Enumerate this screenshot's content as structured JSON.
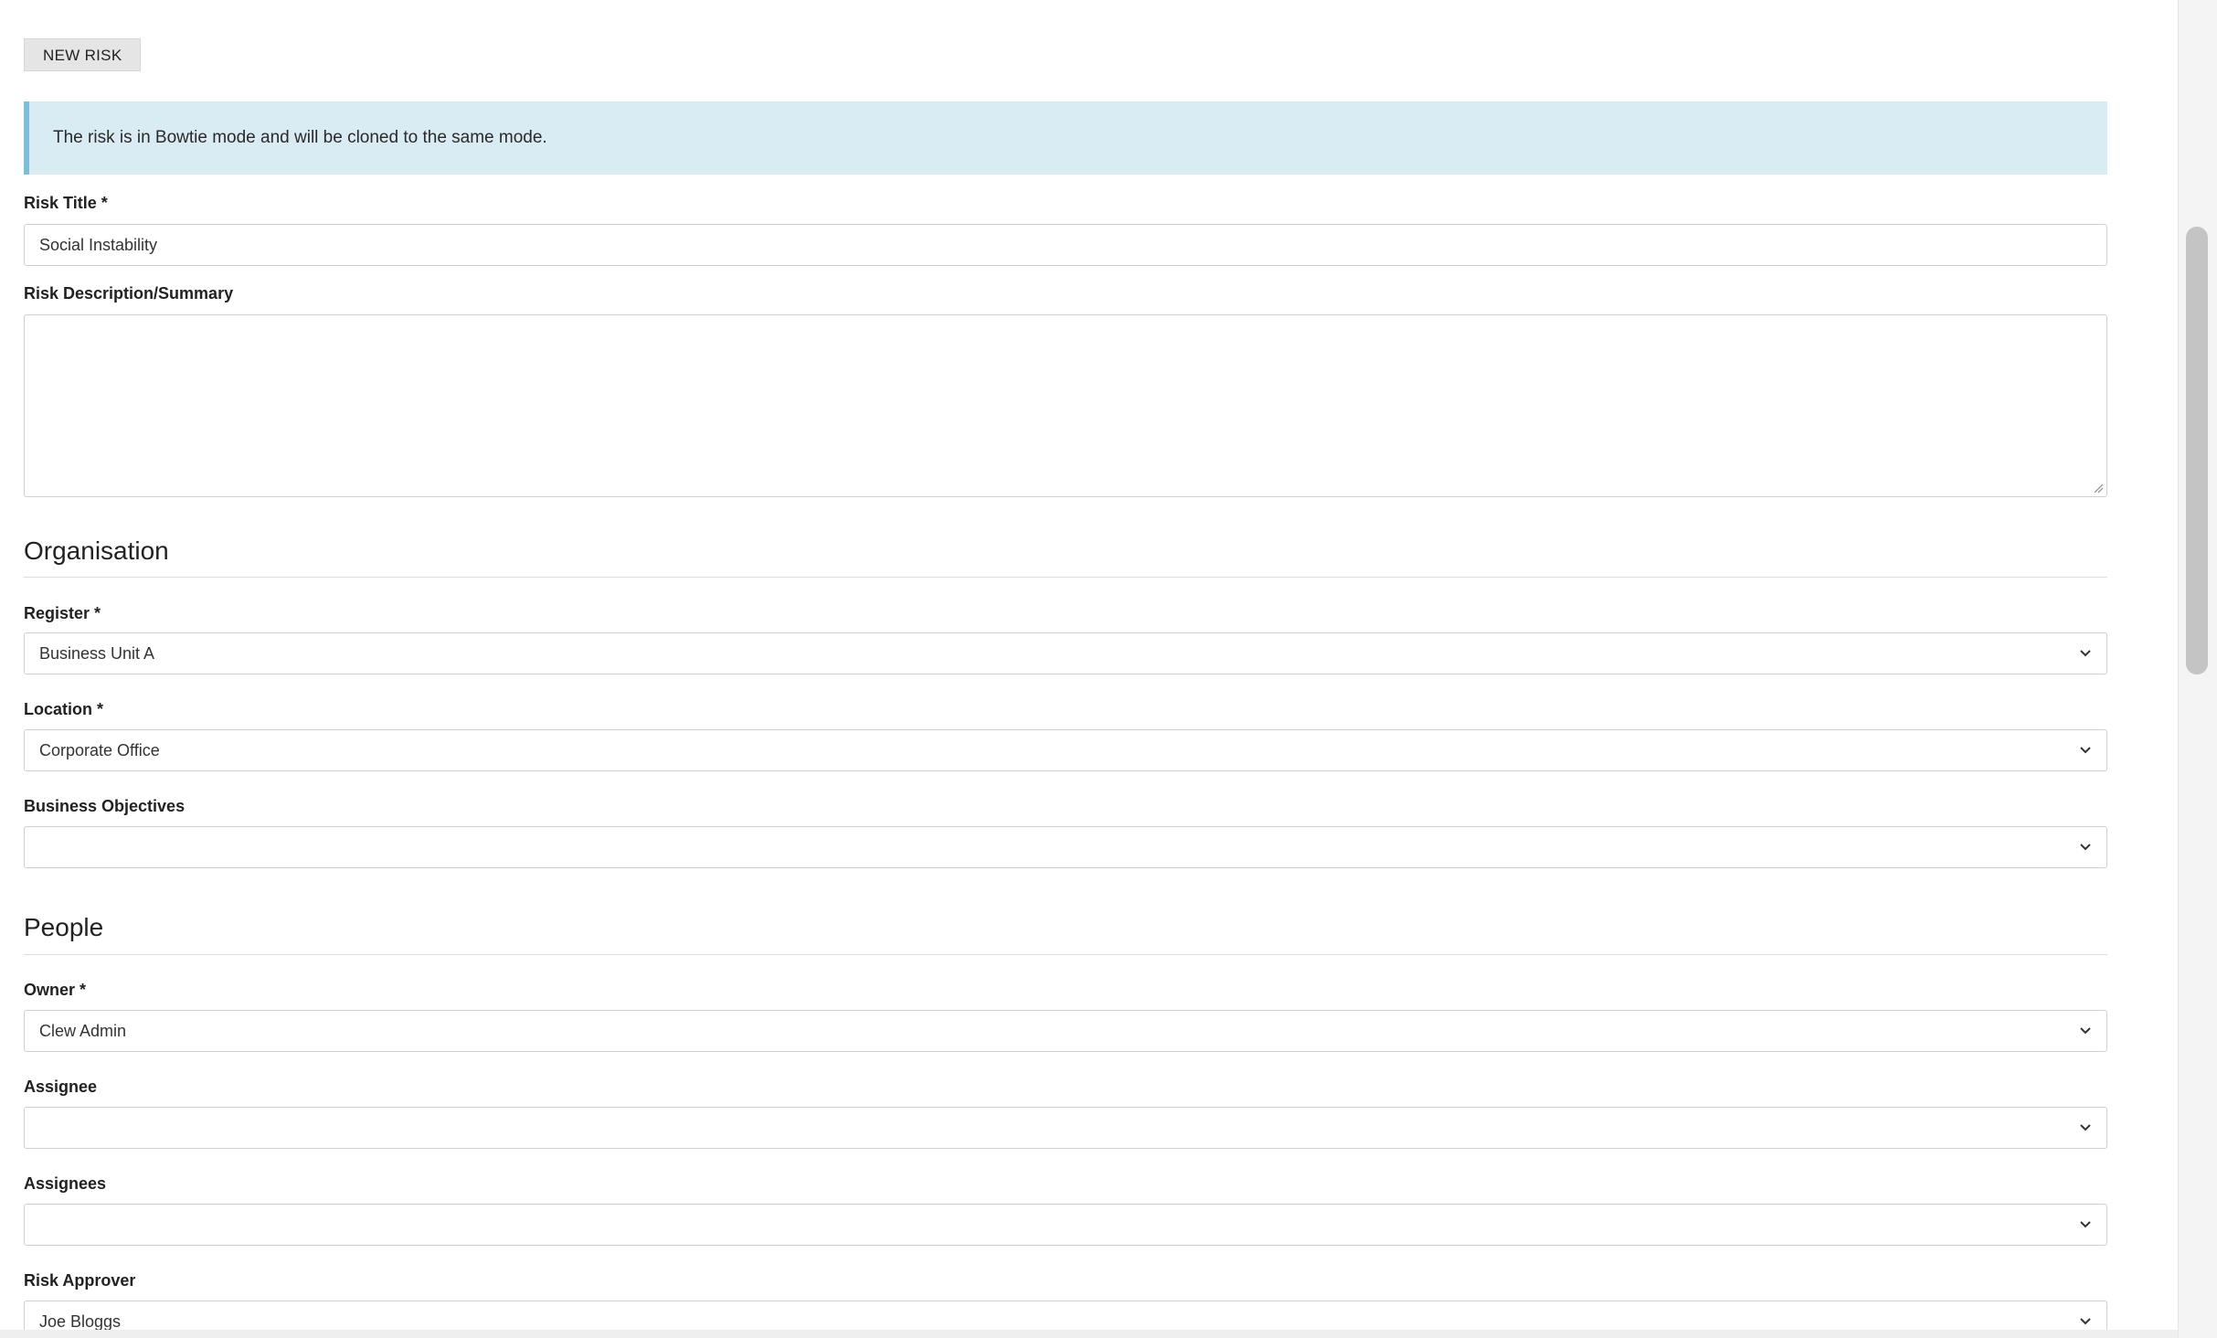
{
  "toolbar": {
    "new_risk_label": "NEW RISK"
  },
  "alert": {
    "text": "The risk is in Bowtie mode and will be cloned to the same mode."
  },
  "fields": {
    "risk_title": {
      "label": "Risk Title *",
      "value": "Social Instability"
    },
    "risk_description": {
      "label": "Risk Description/Summary",
      "value": ""
    }
  },
  "sections": {
    "organisation": {
      "title": "Organisation",
      "register": {
        "label": "Register *",
        "value": "Business Unit A"
      },
      "location": {
        "label": "Location *",
        "value": "Corporate Office"
      },
      "business_objectives": {
        "label": "Business Objectives",
        "value": ""
      }
    },
    "people": {
      "title": "People",
      "owner": {
        "label": "Owner *",
        "value": "Clew Admin"
      },
      "assignee": {
        "label": "Assignee",
        "value": ""
      },
      "assignees": {
        "label": "Assignees",
        "value": ""
      },
      "risk_approver": {
        "label": "Risk Approver",
        "value": "Joe Bloggs"
      }
    }
  },
  "icons": {
    "dropdown": "chevron-down-icon",
    "resize": "resize-grip-icon"
  },
  "colors": {
    "alert_bg": "#d9ebf3",
    "alert_border": "#7fbcd5"
  }
}
